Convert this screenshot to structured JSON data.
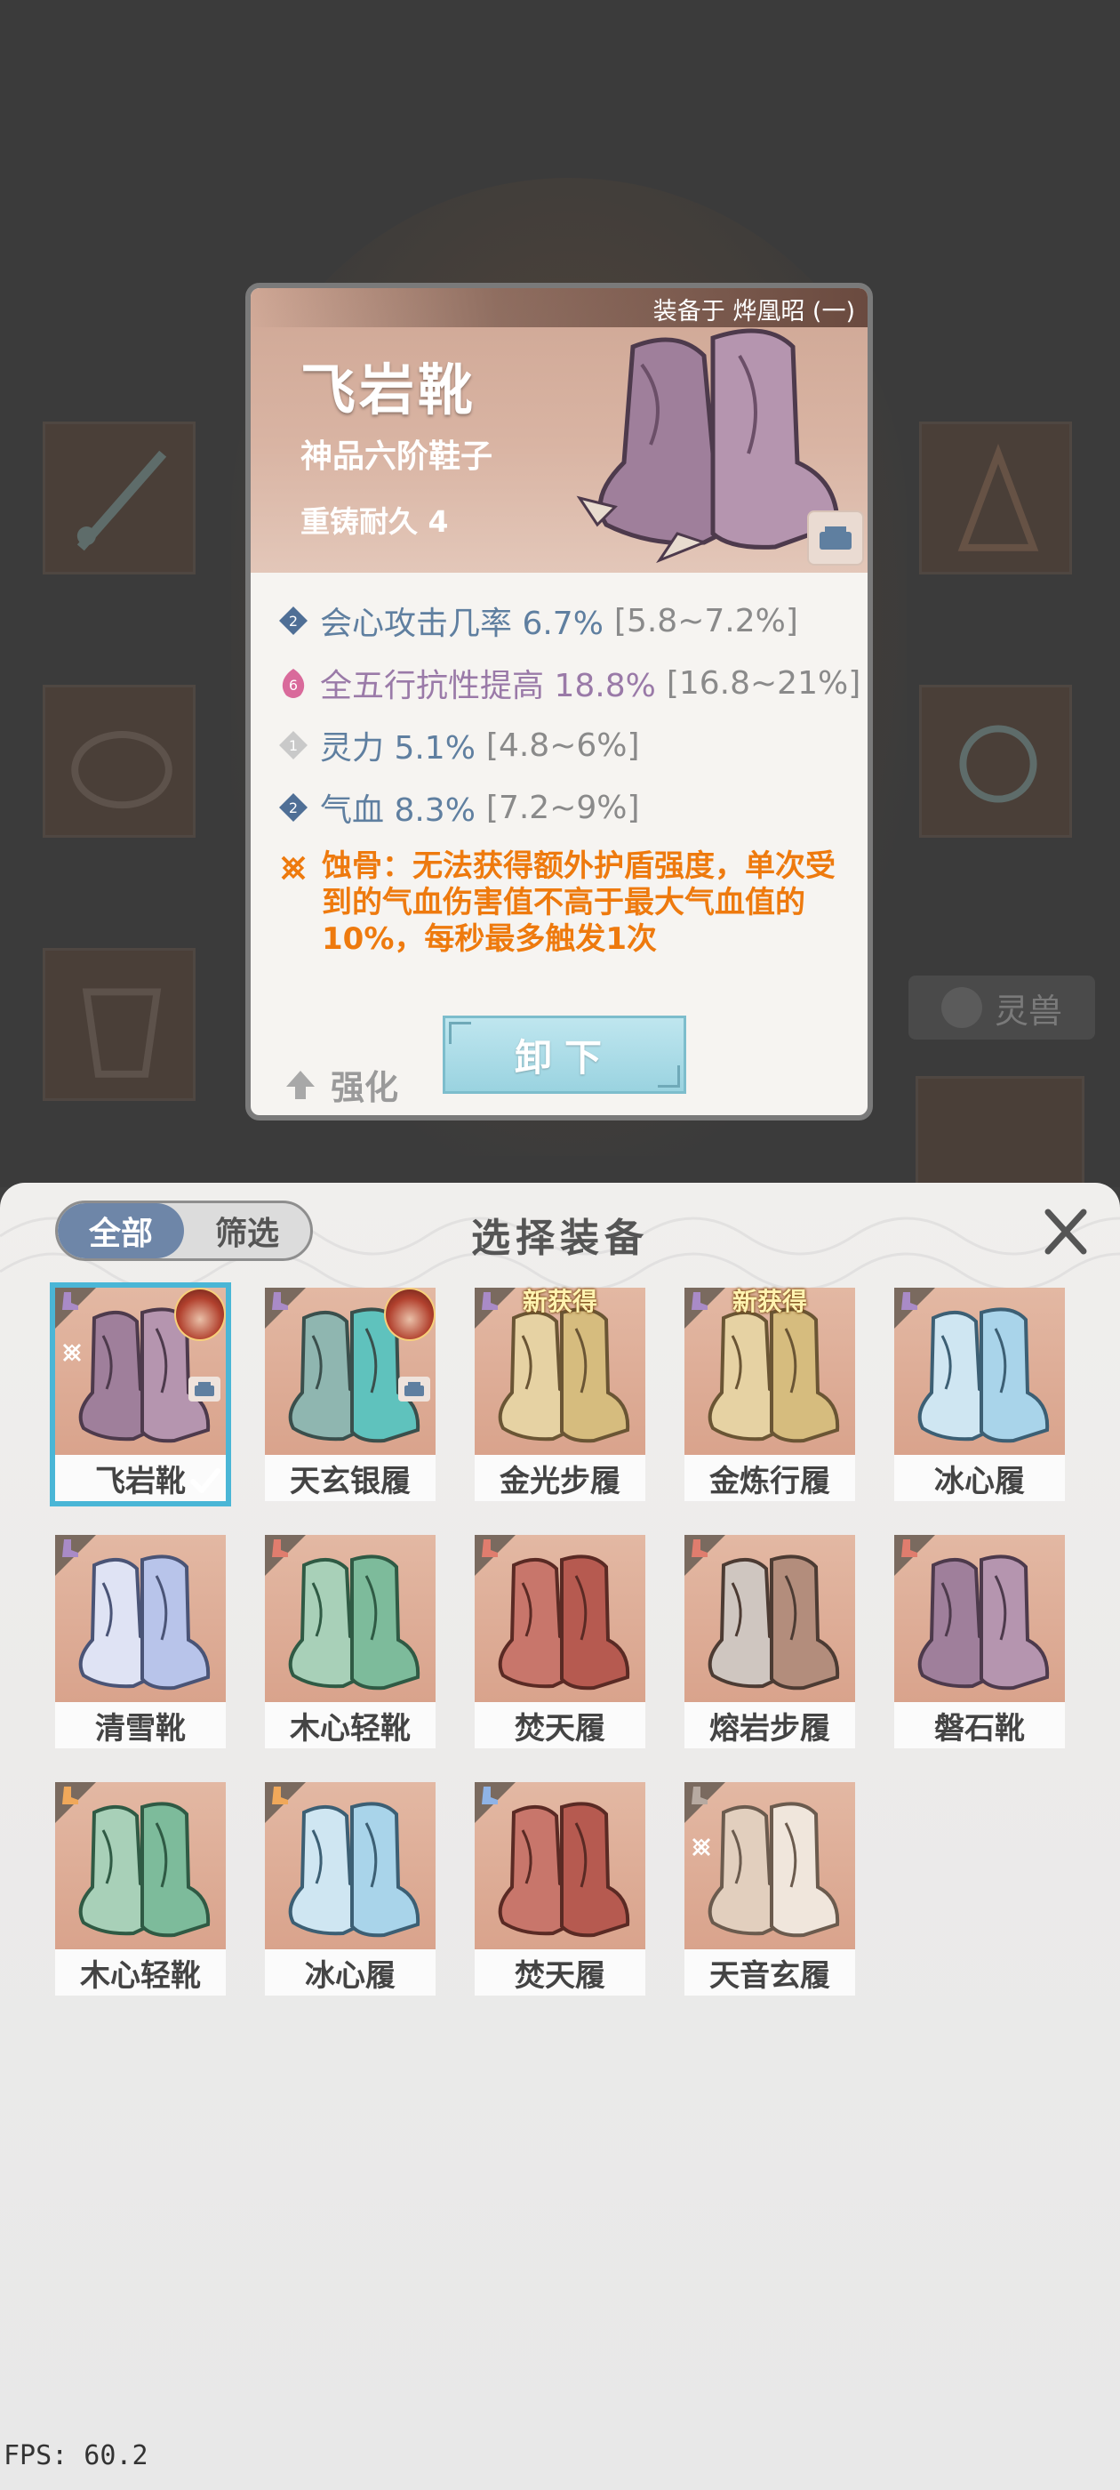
{
  "popup": {
    "equipped_label": "装备于 烨凰昭 (一)",
    "item_name": "飞岩靴",
    "grade": "神品六阶鞋子",
    "reforge": "重铸耐久 4",
    "stats": [
      {
        "text": "会心攻击几率 6.7%",
        "range": "[5.8~7.2%]",
        "gem": "2",
        "gem_color": "#4f6f96"
      },
      {
        "text": "全五行抗性提高 18.8%",
        "range": "[16.8~21%]",
        "gem": "6",
        "gem_color": "#d96a9b"
      },
      {
        "text": "灵力 5.1%",
        "range": "[4.8~6%]",
        "gem": "1",
        "gem_color": "#c9c9c9"
      },
      {
        "text": "气血 8.3%",
        "range": "[7.2~9%]",
        "gem": "2",
        "gem_color": "#4f6f96"
      }
    ],
    "curse_text": "蚀骨：无法获得额外护盾强度，单次受到的气血伤害值不高于最大气血值的10%，每秒最多触发1次",
    "enhance_label": "强化",
    "unload_label": "卸下",
    "accent_color": "#ee7a0e"
  },
  "background": {
    "pet_button_label": "灵兽"
  },
  "panel": {
    "tab_all": "全部",
    "tab_filter": "筛选",
    "title": "选择装备",
    "new_badge": "新获得",
    "items": [
      {
        "label": "飞岩靴",
        "style": "purple",
        "quality": "purple",
        "avatar": true,
        "lock": true,
        "curse": true,
        "selected": true
      },
      {
        "label": "天玄银履",
        "style": "teal",
        "quality": "purple",
        "avatar": true,
        "lock": true
      },
      {
        "label": "金光步履",
        "style": "gold",
        "quality": "purple",
        "new": true
      },
      {
        "label": "金炼行履",
        "style": "gold",
        "quality": "purple",
        "new": true
      },
      {
        "label": "冰心履",
        "style": "ice",
        "quality": "purple"
      },
      {
        "label": "清雪靴",
        "style": "frost",
        "quality": "purple"
      },
      {
        "label": "木心轻靴",
        "style": "jade",
        "quality": "red"
      },
      {
        "label": "焚天履",
        "style": "red",
        "quality": "red"
      },
      {
        "label": "熔岩步履",
        "style": "lava",
        "quality": "red"
      },
      {
        "label": "磐石靴",
        "style": "purple",
        "quality": "red"
      },
      {
        "label": "木心轻靴",
        "style": "jade",
        "quality": "orange"
      },
      {
        "label": "冰心履",
        "style": "ice",
        "quality": "orange"
      },
      {
        "label": "焚天履",
        "style": "red",
        "quality": "blue"
      },
      {
        "label": "天音玄履",
        "style": "thread",
        "quality": "grey",
        "curse": true
      }
    ]
  },
  "fps": "FPS: 60.2"
}
